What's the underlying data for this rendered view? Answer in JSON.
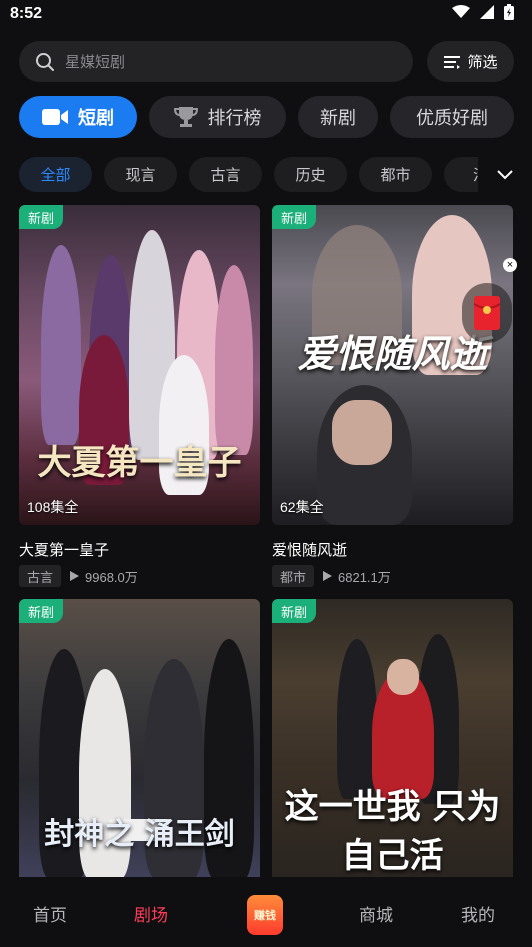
{
  "status": {
    "time": "8:52"
  },
  "search": {
    "placeholder": "星媒短剧"
  },
  "filter": {
    "label": "筛选"
  },
  "main_tabs": [
    {
      "label": "短剧",
      "active": true,
      "icon": "video-camera-icon"
    },
    {
      "label": "排行榜",
      "active": false,
      "icon": "trophy-icon"
    },
    {
      "label": "新剧",
      "active": false
    },
    {
      "label": "优质好剧",
      "active": false
    }
  ],
  "categories": [
    {
      "label": "全部",
      "active": true
    },
    {
      "label": "现言"
    },
    {
      "label": "古言"
    },
    {
      "label": "历史"
    },
    {
      "label": "都市"
    },
    {
      "label": "活"
    }
  ],
  "cards": [
    {
      "badge": "新剧",
      "poster_title": "大夏第一皇子",
      "episodes": "108集全",
      "title": "大夏第一皇子",
      "genre": "古言",
      "views": "9968.0万"
    },
    {
      "badge": "新剧",
      "poster_title": "爱恨随风逝",
      "episodes": "62集全",
      "title": "爱恨随风逝",
      "genre": "都市",
      "views": "6821.1万"
    },
    {
      "badge": "新剧",
      "poster_title": "封神之 涌王剑",
      "episodes": "",
      "title": "",
      "genre": "",
      "views": ""
    },
    {
      "badge": "新剧",
      "poster_title": "这一世我 只为自己活",
      "episodes": "",
      "title": "",
      "genre": "",
      "views": ""
    }
  ],
  "nav": [
    {
      "label": "首页",
      "active": false
    },
    {
      "label": "剧场",
      "active": true
    },
    {
      "label": "赚钱",
      "active": false,
      "icon": "earn-money-icon"
    },
    {
      "label": "商城",
      "active": false
    },
    {
      "label": "我的",
      "active": false
    }
  ],
  "colors": {
    "accent": "#1a7cf0",
    "nav_active": "#ff3d5a",
    "badge_new": "#1bb07a",
    "background": "#0f0f11"
  }
}
